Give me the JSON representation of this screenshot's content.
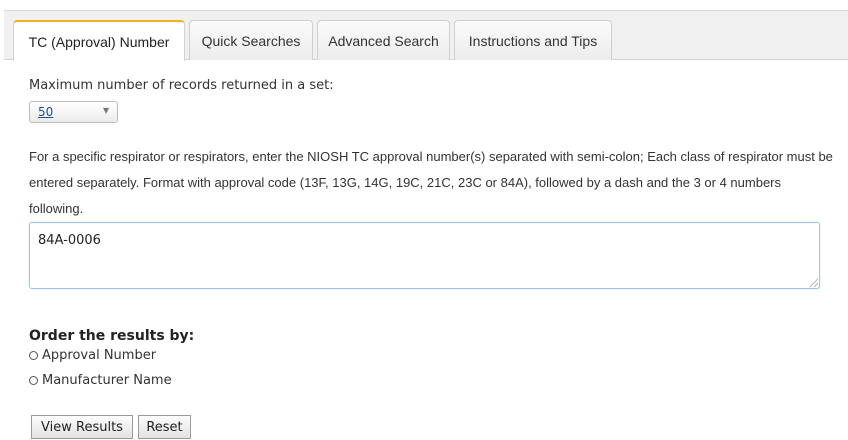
{
  "tabs": [
    {
      "label": "TC (Approval) Number",
      "active": true
    },
    {
      "label": "Quick Searches",
      "active": false
    },
    {
      "label": "Advanced Search",
      "active": false
    },
    {
      "label": "Instructions and Tips",
      "active": false
    }
  ],
  "records": {
    "label": "Maximum number of records returned in a set:",
    "selected": "50"
  },
  "instructions": "For a specific respirator or respirators, enter the NIOSH TC approval number(s) separated with semi-colon; Each class of respirator must be entered separately. Format with approval code (13F, 13G, 14G, 19C, 21C, 23C or 84A), followed by a dash and the 3 or 4 numbers following.",
  "approval_input": {
    "value": "84A-0006"
  },
  "order": {
    "heading": "Order the results by:",
    "options": [
      "Approval Number",
      "Manufacturer Name"
    ]
  },
  "buttons": {
    "view": "View Results",
    "reset": "Reset"
  },
  "colors": {
    "active_tab_accent": "#f0b31c",
    "link": "#1a4f99",
    "input_focus": "#9fc3e6"
  }
}
